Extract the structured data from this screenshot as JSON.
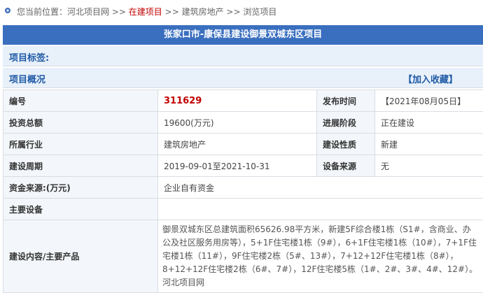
{
  "breadcrumb": {
    "prefix": "您当前位置：",
    "items": [
      "河北项目网",
      "在建项目",
      "建筑房地产",
      "浏览项目"
    ],
    "separator": ">>"
  },
  "page_title": "张家口市-康保县建设御景双城东区项目",
  "tags_label": "项目标签:",
  "overview": {
    "label": "项目概况",
    "favorite": "【加入收藏】"
  },
  "rows": {
    "r1": {
      "k1": "编号",
      "v1": "311629",
      "k2": "发布时间",
      "v2": "【2021年08月05日】"
    },
    "r2": {
      "k1": "投资总额",
      "v1": "19600(万元)",
      "k2": "进展阶段",
      "v2": "正在建设"
    },
    "r3": {
      "k1": "所属行业",
      "v1": "建筑房地产",
      "k2": "建设性质",
      "v2": "新建"
    },
    "r4": {
      "k1": "建设周期",
      "v1": "2019-09-01至2021-10-31",
      "k2": "设备来源",
      "v2": "无"
    },
    "funding": {
      "k": "资金来源:(万元)",
      "v": "企业自有资金"
    },
    "equipment": {
      "k": "主要设备",
      "v": ""
    },
    "content": {
      "k": "建设内容/主要产品",
      "v": "御景双城东区总建筑面积65626.98平方米，新建5F综合楼1栋（S1#，含商业、办公及社区服务用房等），5+1F住宅楼1栋（9#），6+1F住宅楼1栋（10#），7+1F住宅楼1栋（11#），9F住宅楼2栋（5#、13#），7+12+12F住宅楼1栋（8#），8+12+12F住宅楼2栋（6#、7#），12F住宅楼5栋（1#、2#、3#、4#、12#）。河北项目网"
    }
  },
  "colors": {
    "title_bg": "#3a6fbf",
    "accent_blue": "#1f5aa6",
    "highlight_red": "#c00000",
    "section_bg": "#e8f0fa"
  }
}
